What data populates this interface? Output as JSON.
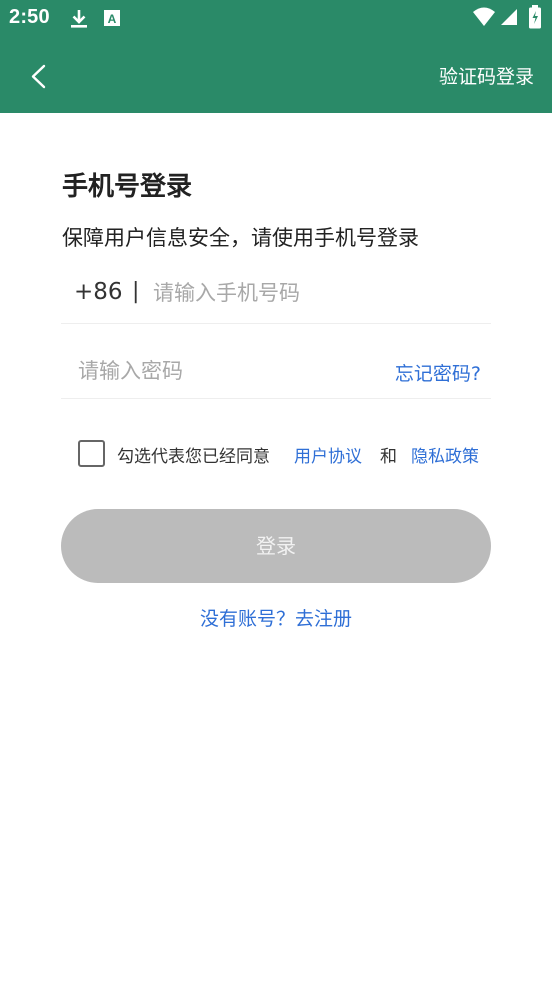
{
  "status_bar": {
    "time": "2:50",
    "icons": [
      "download-icon",
      "a-notification-icon",
      "wifi-icon",
      "signal-icon",
      "battery-icon"
    ]
  },
  "app_bar": {
    "back_icon": "chevron-left-icon",
    "action_label": "验证码登录"
  },
  "login": {
    "title": "手机号登录",
    "subtitle": "保障用户信息安全，请使用手机号登录",
    "country_code": "+86",
    "separator": "|",
    "phone_placeholder": "请输入手机号码",
    "phone_value": "",
    "password_placeholder": "请输入密码",
    "password_value": "",
    "forgot_label": "忘记密码?",
    "agree": {
      "checked": false,
      "text": "勾选代表您已经同意",
      "user_agreement": "用户协议",
      "and": "和",
      "privacy_policy": "隐私政策"
    },
    "submit_label": "登录",
    "register_label": "没有账号？去注册"
  },
  "colors": {
    "header": "#2a8a68",
    "link": "#2f6fd6",
    "button_disabled": "#bbbbbb"
  }
}
